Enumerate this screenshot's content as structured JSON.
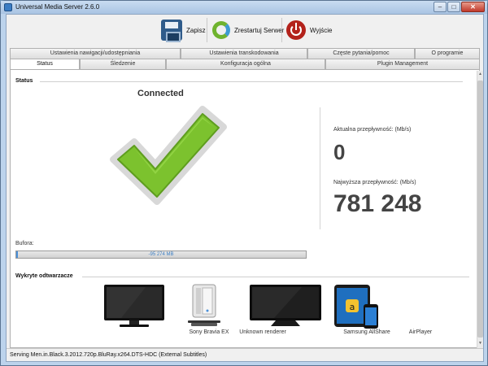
{
  "window": {
    "title": "Universal Media Server 2.6.0",
    "controls": [
      "–",
      "□",
      "✕"
    ]
  },
  "toolbar": {
    "save_label": "Zapisz",
    "restart_label": "Zrestartuj Serwer",
    "exit_label": "Wyjście"
  },
  "tabs": {
    "back": [
      "Ustawienia nawigacji/udostępniania",
      "Ustawienia transkodowania",
      "Częste pytania/pomoc",
      "O programie"
    ],
    "front": [
      "Status",
      "Śledzenie",
      "Konfiguracja ogólna",
      "Plugin Management"
    ],
    "active": "Status"
  },
  "status": {
    "section_title": "Status",
    "connection": "Connected",
    "current_rate_label": "Aktualna przepływność: (Mb/s)",
    "current_rate_value": "0",
    "peak_rate_label": "Najwyższa przepływność: (Mb/s)",
    "peak_rate_value": "781 248",
    "buffer_label": "Bufora:",
    "buffer_text": "-95 274 MB",
    "buffer_fraction": 0.0
  },
  "renderers": {
    "section_title": "Wykryte odtwarzacze",
    "items": [
      {
        "name": "Sony Bravia EX",
        "icon": "tv-icon"
      },
      {
        "name": "Unknown renderer",
        "icon": "server-icon"
      },
      {
        "name": "Samsung AllShare",
        "icon": "tv-icon"
      },
      {
        "name": "AirPlayer",
        "icon": "tablet-phone-icon"
      }
    ]
  },
  "statusbar": {
    "text": "Serving Men.in.Black.3.2012.720p.BluRay.x264.DTS-HDC (External Subtitles)"
  },
  "colors": {
    "check_green": "#7cc22e",
    "accent_blue": "#4a90d9",
    "exit_red": "#b3221b"
  }
}
